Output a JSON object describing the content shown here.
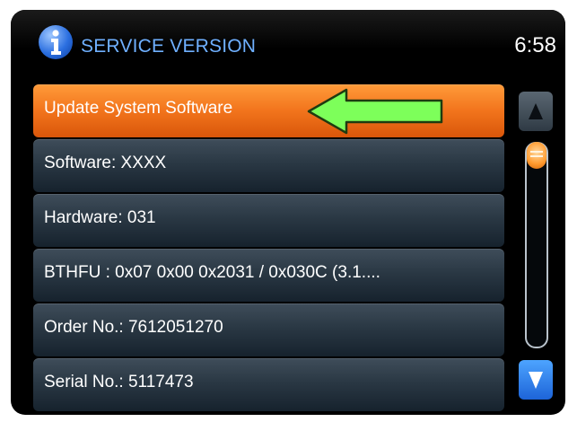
{
  "header": {
    "title": "SERVICE VERSION",
    "clock": "6:58",
    "icon": "info-icon"
  },
  "list": {
    "items": [
      {
        "label": "Update System Software",
        "selected": true
      },
      {
        "label": "Software: XXXX",
        "selected": false
      },
      {
        "label": "Hardware: 031",
        "selected": false
      },
      {
        "label": "BTHFU : 0x07 0x00 0x2031 / 0x030C (3.1....",
        "selected": false
      },
      {
        "label": "Order No.: 7612051270",
        "selected": false
      },
      {
        "label": "Serial No.: 5117473",
        "selected": false
      }
    ]
  },
  "annotation": {
    "icon": "green-arrow-left-icon",
    "color": "#7dff5a"
  },
  "scrollbar": {
    "up_icon": "triangle-up-icon",
    "down_icon": "triangle-down-icon",
    "position": 0
  },
  "colors": {
    "selected_row": "#f2741c",
    "title": "#6fb0ff",
    "accent_blue": "#1d64d8"
  }
}
